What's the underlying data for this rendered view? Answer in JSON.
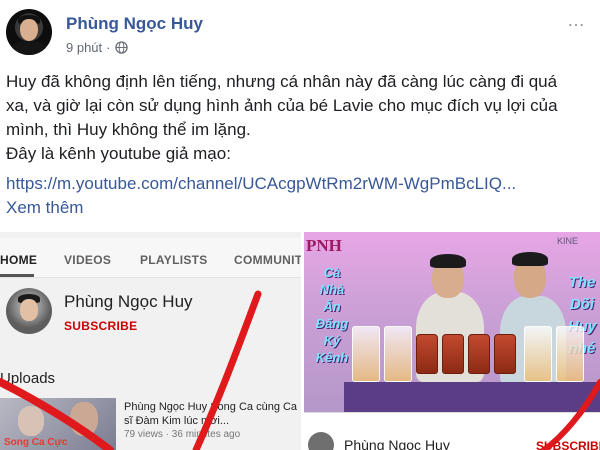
{
  "post": {
    "author": "Phùng Ngọc Huy",
    "time": "9 phút",
    "dot": "·",
    "more_icon": "…",
    "text_lines": [
      "Huy đã không định lên tiếng, nhưng cá nhân này đã càng lúc càng đi quá",
      "xa, và giờ lại còn sử dụng hình ảnh của bé Lavie cho mục đích vụ lợi của",
      "mình, thì Huy không thể im lặng.",
      "Đây là kênh youtube giả mạo:"
    ],
    "link": "https://m.youtube.com/channel/UCAcgpWtRm2rWM-WgPmBcLIQ...",
    "see_more": "Xem thêm",
    "icons": {
      "privacy": "globe-icon",
      "options": "more-options-icon"
    },
    "colors": {
      "link": "#385898",
      "subscribe": "#cc0000",
      "meta": "#616770"
    }
  },
  "photo_left": {
    "tabs": [
      "HOME",
      "VIDEOS",
      "PLAYLISTS",
      "COMMUNIT"
    ],
    "channel_name": "Phùng Ngọc Huy",
    "subscribe": "SUBSCRIBE",
    "uploads": "Uploads",
    "video": {
      "title": "Phùng Ngọc Huy Song Ca cùng Ca sĩ Đàm Kim lúc mới...",
      "meta": "79 views · 36 minutes ago",
      "thumb_caption": "Song Ca Cực"
    }
  },
  "photo_right": {
    "logo": "PNH",
    "watermark": "KINE",
    "left_overlay": "Cà Nhà Ăn Đăng Ký Kênh",
    "right_overlay": "The Dõi Huy nhé",
    "channel_name": "Phùng Ngọc Huy",
    "subscribe": "SUBSCRIBE"
  }
}
